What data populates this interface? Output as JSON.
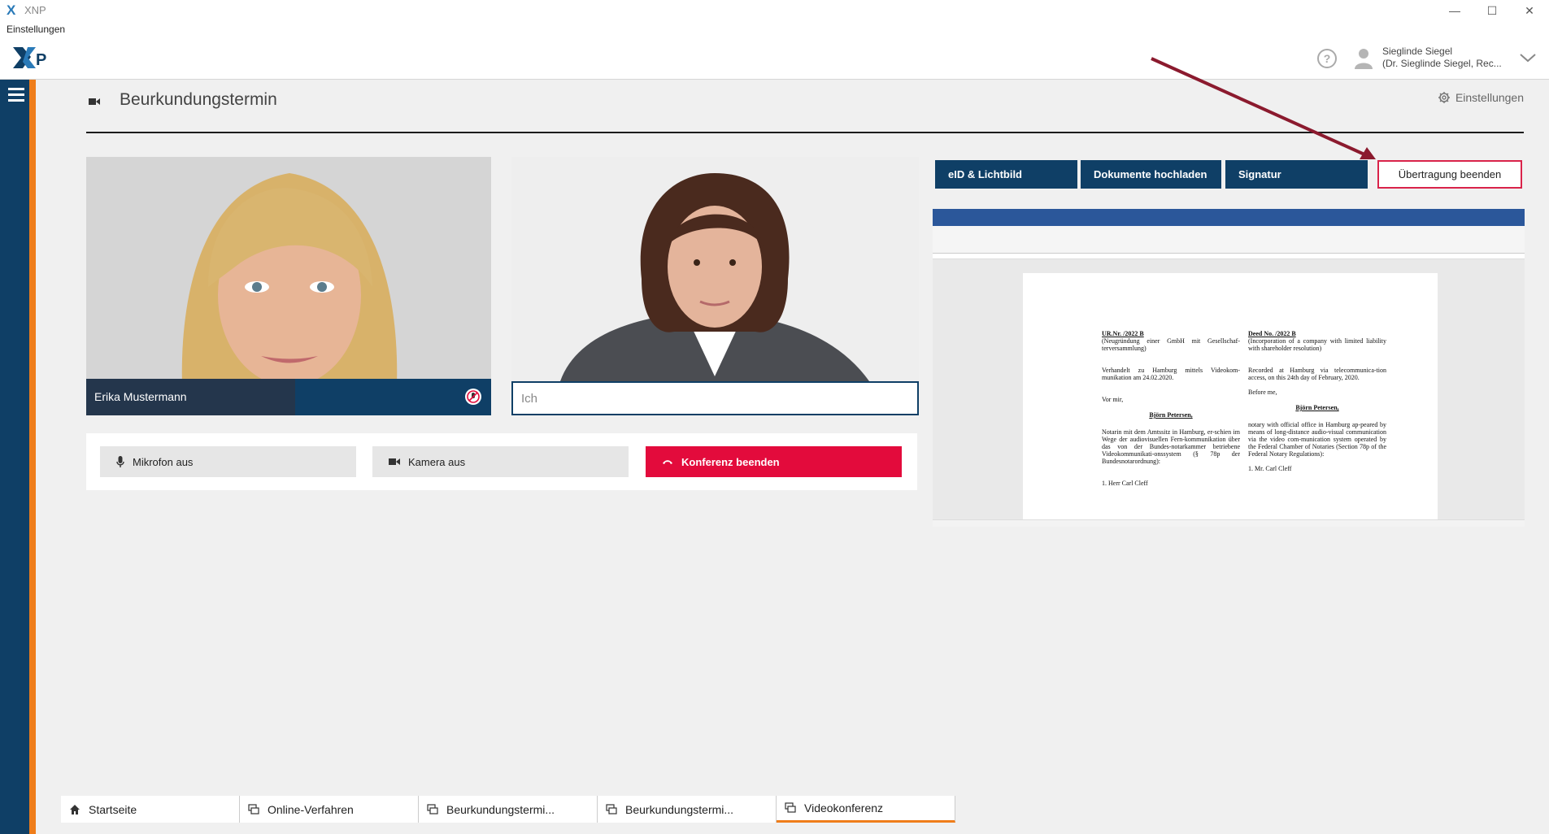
{
  "window": {
    "app_title": "XNP",
    "menu_label": "Einstellungen",
    "minimize": "—",
    "maximize": "☐",
    "close": "✕"
  },
  "header": {
    "logo_text": "XNP",
    "help_label": "?",
    "user": {
      "name": "Sieglinde Siegel",
      "detail": "(Dr. Sieglinde Siegel, Rec..."
    }
  },
  "page": {
    "title": "Beurkundungstermin",
    "settings_label": "Einstellungen"
  },
  "participants": [
    {
      "name": "Erika Mustermann"
    },
    {
      "name": "Ich"
    }
  ],
  "controls": {
    "mic": "Mikrofon aus",
    "camera": "Kamera aus",
    "end": "Konferenz beenden"
  },
  "share": {
    "buttons": [
      "eID & Lichtbild",
      "Dokumente hochladen",
      "Signatur"
    ],
    "stop": "Übertragung beenden"
  },
  "document": {
    "left": {
      "heading": "UR.Nr.        /2022 B",
      "sub": "(Neugründung einer GmbH mit Gesellschaf-terversammlung)",
      "p1": "Verhandelt zu Hamburg mittels Videokom-munikation am 24.02.2020.",
      "p2": "Vor mir,",
      "notary": "Björn Petersen,",
      "p3": "Notarin mit dem Amtssitz in Hamburg, er-schien im Wege der audiovisuellen Fern-kommunikation über das von der Bundes-notarkammer betriebene Videokommunikati-onssystem (§ 78p der Bundesnotarordnung):",
      "p4": "1.  Herr Carl Cleff"
    },
    "right": {
      "heading": "Deed No.            /2022 B",
      "sub": "(Incorporation of a company with limited liability with shareholder resolution)",
      "p1": "Recorded at Hamburg via telecommunica-tion access, on this 24th day of February, 2020.",
      "p2": "Before me,",
      "notary": "Björn Petersen,",
      "p3": "notary with official office in Hamburg ap-peared by means of long-distance audio-visual communication via the video com-munication system operated by the Federal Chamber of Notaries (Section 78p of the Federal Notary Regulations):",
      "p4": "1.  Mr. Carl Cleff"
    }
  },
  "tabs": [
    {
      "label": "Startseite",
      "icon": "home-icon"
    },
    {
      "label": "Online-Verfahren",
      "icon": "chat-icon"
    },
    {
      "label": "Beurkundungstermi...",
      "icon": "chat-icon"
    },
    {
      "label": "Beurkundungstermi...",
      "icon": "chat-icon"
    },
    {
      "label": "Videokonferenz",
      "icon": "chat-icon"
    }
  ],
  "colors": {
    "brand": "#0f3f66",
    "accent": "#ef7d1a",
    "danger": "#e30b3c",
    "annotation": "#8b1a2e"
  }
}
